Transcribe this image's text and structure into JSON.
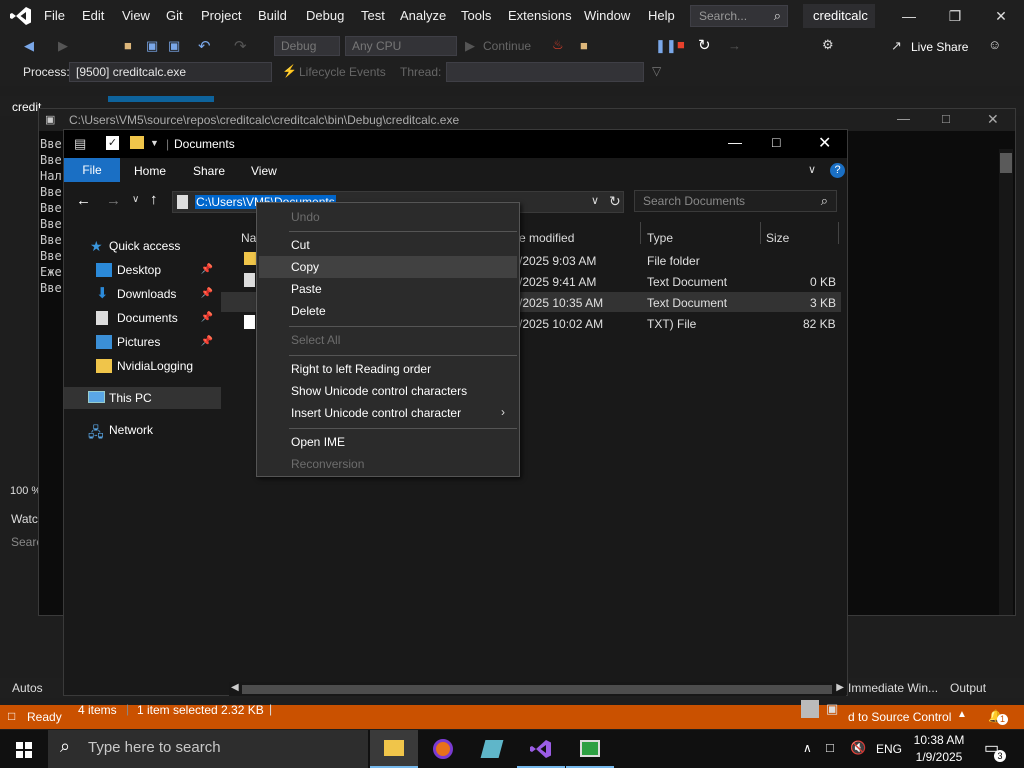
{
  "vs": {
    "menu": [
      "File",
      "Edit",
      "View",
      "Git",
      "Project",
      "Build",
      "Debug",
      "Test",
      "Analyze",
      "Tools",
      "Extensions",
      "Window",
      "Help"
    ],
    "search_placeholder": "Search...",
    "project_name": "creditcalc",
    "toolbar": {
      "config": "Debug",
      "platform": "Any CPU",
      "continue_label": "Continue",
      "live_share": "Live Share"
    },
    "process_label": "Process:",
    "process_value": "[9500] creditcalc.exe",
    "lifecycle_label": "Lifecycle Events",
    "thread_label": "Thread:",
    "tab_label": "credit",
    "zoom": "100 %",
    "watch_label": "Watc",
    "search_label": "Searc",
    "autos_label": "Autos",
    "immediate_label": "Immediate Win...",
    "output_label": "Output",
    "status_ready": "Ready",
    "status_source_control": "d to Source Control",
    "notif_count": "1"
  },
  "console": {
    "title": "C:\\Users\\VM5\\source\\repos\\creditcalc\\creditcalc\\bin\\Debug\\creditcalc.exe",
    "lines": [
      "Вве",
      "Вве",
      "Нал",
      "Вве",
      "Вве",
      "Вве",
      "Вве",
      "Вве",
      "Еже",
      "Вве"
    ]
  },
  "explorer": {
    "title": "Documents",
    "tabs": {
      "file": "File",
      "home": "Home",
      "share": "Share",
      "view": "View"
    },
    "address": "C:\\Users\\VM5\\Documents",
    "search_placeholder": "Search Documents",
    "nav": {
      "quick_access": "Quick access",
      "desktop": "Desktop",
      "downloads": "Downloads",
      "documents": "Documents",
      "pictures": "Pictures",
      "nvidia": "NvidiaLogging",
      "this_pc": "This PC",
      "network": "Network"
    },
    "columns": {
      "name": "Na",
      "modified": "e modified",
      "type": "Type",
      "size": "Size"
    },
    "files": [
      {
        "date": "/2025 9:03 AM",
        "type": "File folder",
        "size": ""
      },
      {
        "date": "/2025 9:41 AM",
        "type": "Text Document",
        "size": "0 KB"
      },
      {
        "date": "/2025 10:35 AM",
        "type": "Text Document",
        "size": "3 KB"
      },
      {
        "date": "/2025 10:02 AM",
        "type": "TXT) File",
        "size": "82 KB"
      }
    ],
    "status": {
      "items": "4 items",
      "selected": "1 item selected  2.32 KB"
    }
  },
  "context_menu": {
    "undo": "Undo",
    "cut": "Cut",
    "copy": "Copy",
    "paste": "Paste",
    "delete": "Delete",
    "select_all": "Select All",
    "rtl": "Right to left Reading order",
    "show_unicode": "Show Unicode control characters",
    "insert_unicode": "Insert Unicode control character",
    "open_ime": "Open IME",
    "reconversion": "Reconversion"
  },
  "taskbar": {
    "search_placeholder": "Type here to search",
    "lang": "ENG",
    "time": "10:38 AM",
    "date": "1/9/2025",
    "notif": "3"
  },
  "colors": {
    "accent": "#1a6fc4",
    "vs_status": "#ca5100",
    "selection": "#0066cc"
  }
}
